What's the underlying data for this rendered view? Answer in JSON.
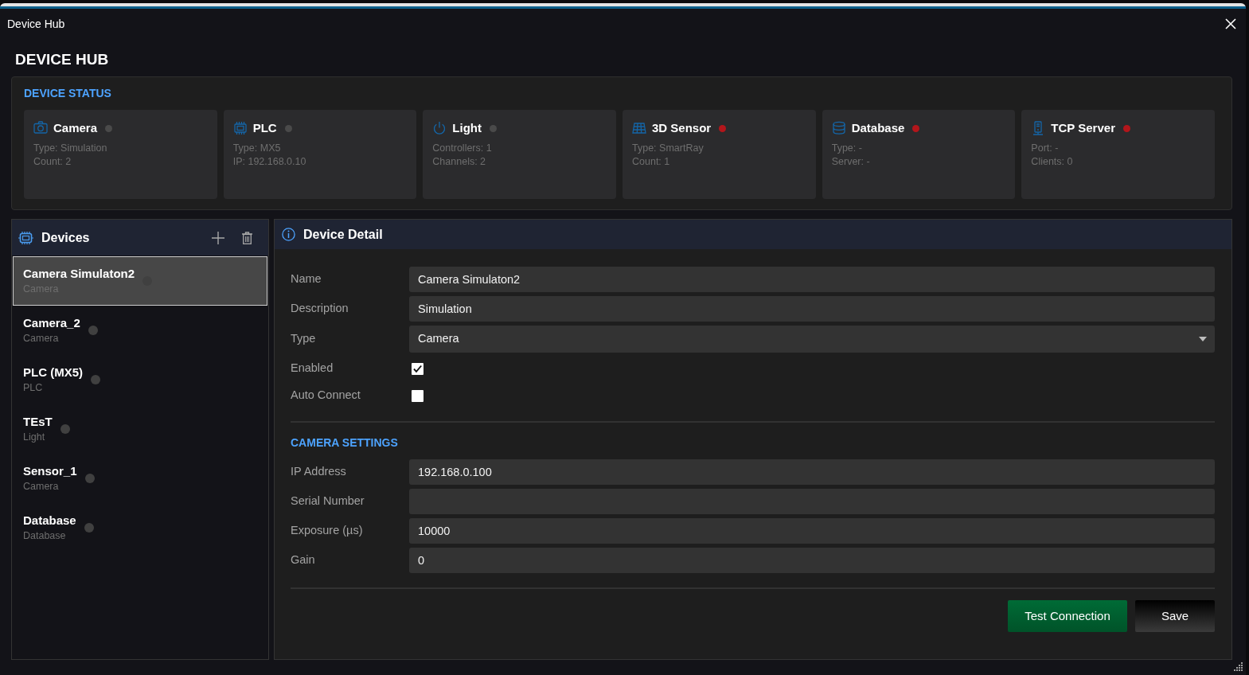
{
  "window": {
    "title": "Device Hub"
  },
  "heading": "DEVICE HUB",
  "device_status": {
    "title": "DEVICE STATUS",
    "cards": [
      {
        "kind": "camera",
        "name": "Camera",
        "color": "#4a4a4a",
        "lines": [
          "Type: Simulation",
          "Count: 2"
        ]
      },
      {
        "kind": "chip",
        "name": "PLC",
        "color": "#4a4a4a",
        "lines": [
          "Type: MX5",
          "IP: 192.168.0.10"
        ]
      },
      {
        "kind": "power",
        "name": "Light",
        "color": "#4a4a4a",
        "lines": [
          "Controllers: 1",
          "Channels: 2"
        ]
      },
      {
        "kind": "grid",
        "name": "3D Sensor",
        "color": "#b3161b",
        "lines": [
          "Type: SmartRay",
          "Count: 1"
        ]
      },
      {
        "kind": "database",
        "name": "Database",
        "color": "#b3161b",
        "lines": [
          "Type: -",
          "Server: -"
        ]
      },
      {
        "kind": "server",
        "name": "TCP Server",
        "color": "#b3161b",
        "lines": [
          "Port: -",
          "Clients: 0"
        ]
      }
    ]
  },
  "devices": {
    "title": "Devices",
    "items": [
      {
        "name": "Camera Simulaton2",
        "type": "Camera",
        "selected": true,
        "color": "#404040"
      },
      {
        "name": "Camera_2",
        "type": "Camera",
        "selected": false,
        "color": "#404040"
      },
      {
        "name": "PLC (MX5)",
        "type": "PLC",
        "selected": false,
        "color": "#404040"
      },
      {
        "name": "TEsT",
        "type": "Light",
        "selected": false,
        "color": "#404040"
      },
      {
        "name": "Sensor_1",
        "type": "Camera",
        "selected": false,
        "color": "#404040"
      },
      {
        "name": "Database",
        "type": "Database",
        "selected": false,
        "color": "#404040"
      }
    ]
  },
  "detail": {
    "title": "Device Detail",
    "fields": [
      {
        "kind": "text",
        "label": "Name",
        "value": "Camera Simulaton2"
      },
      {
        "kind": "text",
        "label": "Description",
        "value": "Simulation"
      },
      {
        "kind": "select",
        "label": "Type",
        "value": "Camera"
      },
      {
        "kind": "checkbox",
        "label": "Enabled",
        "checked": true
      },
      {
        "kind": "checkbox",
        "label": "Auto Connect",
        "checked": false
      }
    ],
    "section_title": "CAMERA SETTINGS",
    "settings": [
      {
        "kind": "text",
        "label": "IP Address",
        "value": "192.168.0.100"
      },
      {
        "kind": "text",
        "label": "Serial Number"
      },
      {
        "kind": "text",
        "label": "Exposure (µs)",
        "value": "10000"
      },
      {
        "kind": "text",
        "label": "Gain",
        "value": "0"
      }
    ],
    "buttons": [
      {
        "kind": "test",
        "label": "Test Connection"
      },
      {
        "kind": "save",
        "label": "Save"
      }
    ]
  }
}
